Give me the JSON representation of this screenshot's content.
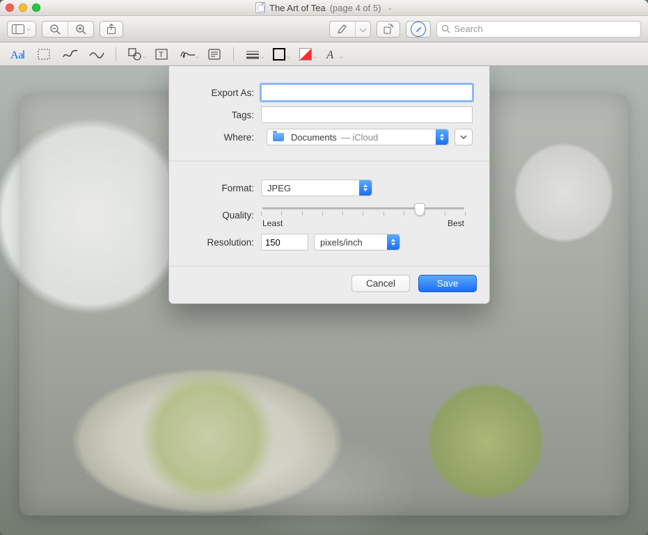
{
  "window": {
    "title": "The Art of Tea",
    "page_suffix": "(page 4 of 5)"
  },
  "toolbar1": {
    "search_placeholder": "Search"
  },
  "export_sheet": {
    "labels": {
      "export_as": "Export As:",
      "tags": "Tags:",
      "where": "Where:",
      "format": "Format:",
      "quality": "Quality:",
      "resolution": "Resolution:"
    },
    "export_as_value": "",
    "tags_value": "",
    "where": {
      "folder": "Documents",
      "location_suffix": "— iCloud"
    },
    "format_value": "JPEG",
    "quality": {
      "least_label": "Least",
      "best_label": "Best",
      "percent": 78
    },
    "resolution": {
      "value": "150",
      "unit": "pixels/inch"
    },
    "buttons": {
      "cancel": "Cancel",
      "save": "Save"
    }
  }
}
